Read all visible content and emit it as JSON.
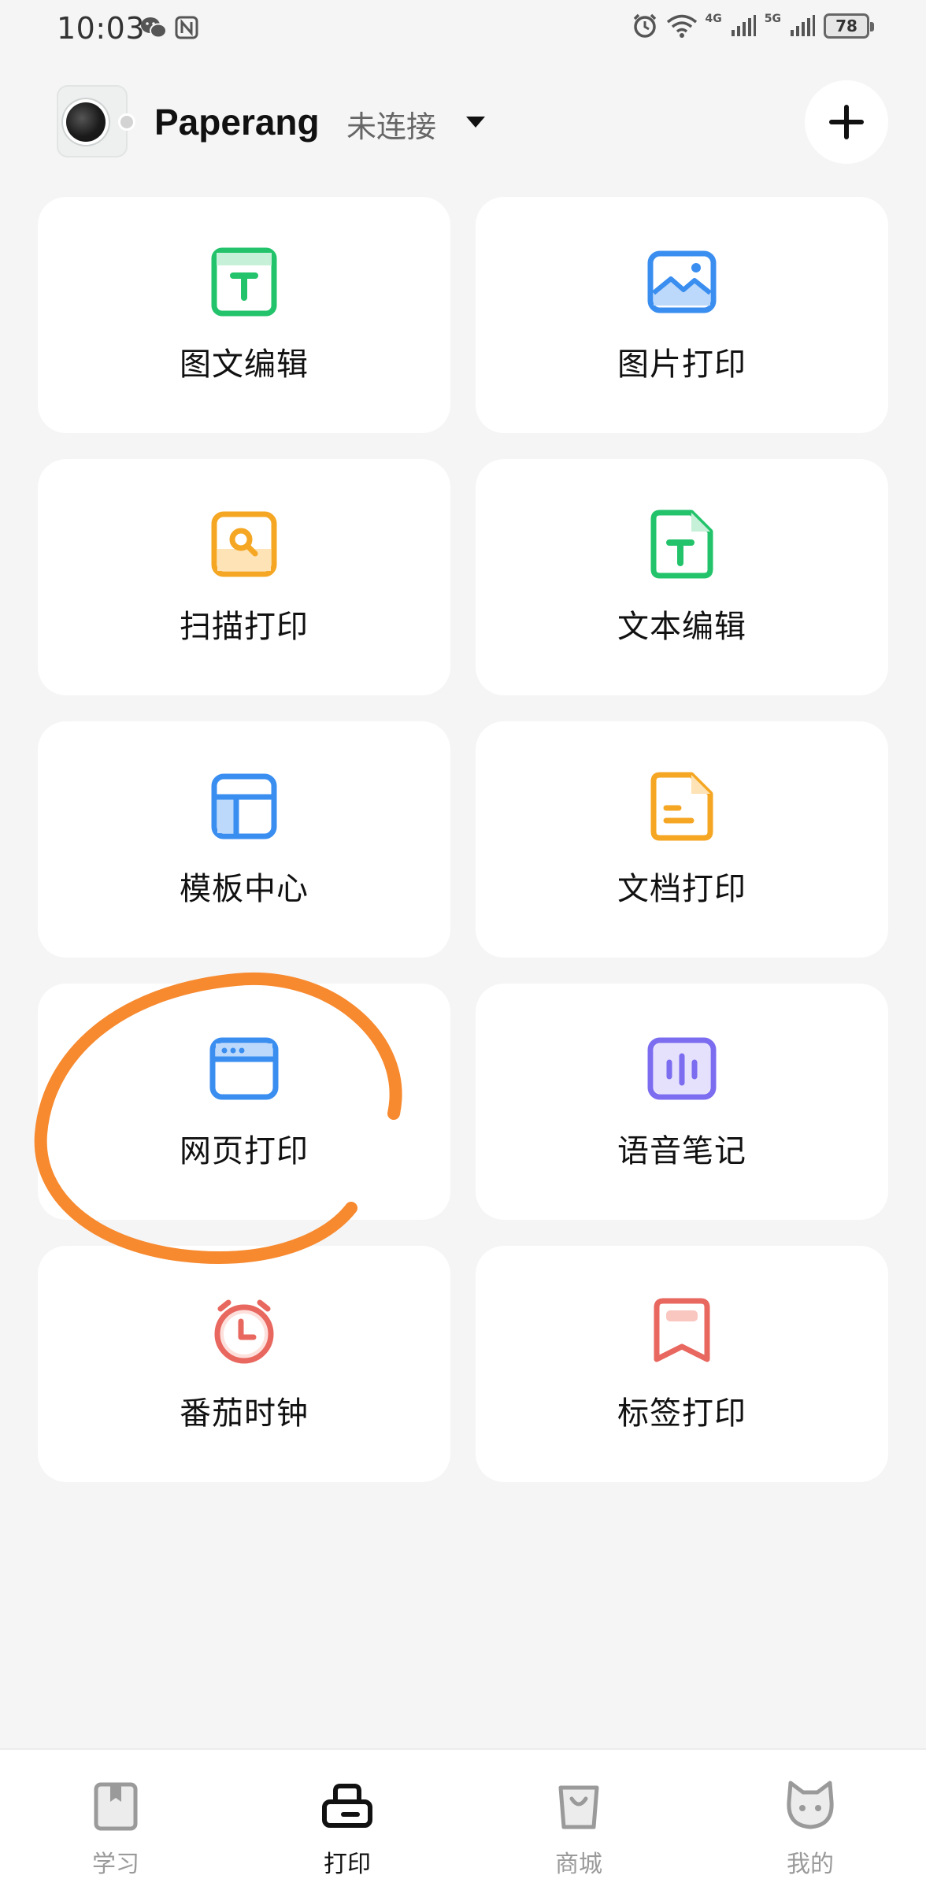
{
  "status_bar": {
    "time": "10:03",
    "battery": "78",
    "network_1": "4G",
    "network_2": "5G",
    "icons": [
      "wechat-icon",
      "nfc-icon",
      "alarm-icon",
      "wifi-icon",
      "signal-icon",
      "signal-icon",
      "battery-icon"
    ]
  },
  "header": {
    "device_name": "Paperang",
    "connection_status": "未连接",
    "add_icon": "plus-icon"
  },
  "tiles": [
    {
      "label": "图文编辑",
      "icon": "image-text-edit-icon",
      "color": "#22c36a"
    },
    {
      "label": "图片打印",
      "icon": "image-print-icon",
      "color": "#3a8ef0"
    },
    {
      "label": "扫描打印",
      "icon": "scan-print-icon",
      "color": "#f5a623"
    },
    {
      "label": "文本编辑",
      "icon": "text-edit-icon",
      "color": "#22c36a"
    },
    {
      "label": "模板中心",
      "icon": "template-center-icon",
      "color": "#3a8ef0"
    },
    {
      "label": "文档打印",
      "icon": "document-print-icon",
      "color": "#f5a623"
    },
    {
      "label": "网页打印",
      "icon": "web-print-icon",
      "color": "#3a8ef0"
    },
    {
      "label": "语音笔记",
      "icon": "voice-note-icon",
      "color": "#7b6cf0"
    },
    {
      "label": "番茄时钟",
      "icon": "pomodoro-clock-icon",
      "color": "#e8675f"
    },
    {
      "label": "标签打印",
      "icon": "label-print-icon",
      "color": "#e8675f"
    }
  ],
  "annotation": {
    "color": "#f7892e"
  },
  "bottom_nav": [
    {
      "label": "学习",
      "icon": "book-icon",
      "active": false
    },
    {
      "label": "打印",
      "icon": "printer-icon",
      "active": true
    },
    {
      "label": "商城",
      "icon": "shopping-bag-icon",
      "active": false
    },
    {
      "label": "我的",
      "icon": "cat-face-icon",
      "active": false
    }
  ]
}
